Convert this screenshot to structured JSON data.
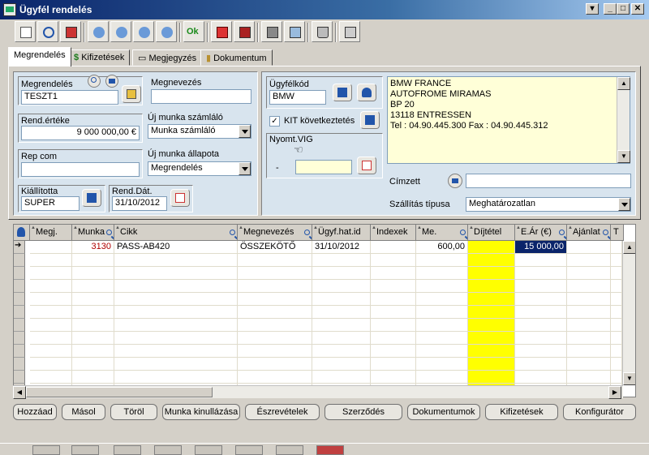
{
  "window": {
    "title": "Ügyfél rendelés",
    "controls": [
      "▾",
      "_",
      "□",
      "✕"
    ]
  },
  "toolbar": {
    "ok_label": "Ok",
    "icons": [
      "new-icon",
      "search-icon",
      "copy-icon",
      "first-icon",
      "prev-icon",
      "next-icon",
      "last-icon",
      "ok-icon",
      "delete-icon",
      "exit-icon",
      "print-icon",
      "preview-icon",
      "trash-icon",
      "stack-icon"
    ]
  },
  "tabs": [
    {
      "label": "Megrendelés",
      "active": true
    },
    {
      "label": "Kifizetések",
      "active": false
    },
    {
      "label": "Megjegyzés",
      "active": false
    },
    {
      "label": "Dokumentum",
      "active": false
    }
  ],
  "form": {
    "order_label": "Megrendelés",
    "order_value": "TESZT1",
    "name_label": "Megnevezés",
    "name_value": "",
    "order_value_label": "Rend.értéke",
    "order_value_amount": "9 000 000,00 €",
    "new_work_account_label": "Új munka számláló",
    "new_work_account_value": "Munka számláló",
    "rep_label": "Rep com",
    "rep_value": "",
    "new_work_status_label": "Új munka állapota",
    "new_work_status_value": "Megrendelés",
    "issuer_label": "Kiállította",
    "issuer_value": "SUPER",
    "order_date_label": "Rend.Dát.",
    "order_date_value": "31/10/2012",
    "customer_code_label": "Ügyfélkód",
    "customer_code_value": "BMW",
    "kit_label": "KIT következtetés",
    "kit_checked": "✓",
    "print_label": "Nyomt.VIG",
    "print_dash": "-",
    "address_lines": [
      "BMW FRANCE",
      "AUTOFROME MIRAMAS",
      "BP 20",
      "13118 ENTRESSEN",
      "Tel : 04.90.445.300 Fax : 04.90.445.312"
    ],
    "recipient_label": "Címzett",
    "recipient_value": "",
    "shipping_label": "Szállítás típusa",
    "shipping_value": "Meghatározatlan"
  },
  "grid": {
    "columns": [
      "Megj.",
      "Munka",
      "Cikk",
      "Megnevezés",
      "Ügyf.hat.id",
      "Indexek",
      "Me.",
      "Díjtétel",
      "E.Ár (€)",
      "Ajánlat",
      "T"
    ],
    "rows": [
      {
        "megj": "",
        "munka": "3130",
        "cikk": "PASS-AB420",
        "megnevezes": "ÖSSZEKÖTŐ",
        "hatid": "31/10/2012",
        "indexek": "",
        "me": "600,00",
        "dijtetel": "",
        "ear": "15 000,00",
        "ajanlat": ""
      }
    ],
    "empty_rows": 11
  },
  "buttons": {
    "add": "Hozzáad",
    "copy": "Másol",
    "delete": "Töröl",
    "work_issue": "Munka kinullázása",
    "remarks": "Észrevételek",
    "contract": "Szerződés",
    "documents": "Dokumentumok",
    "payments": "Kifizetések",
    "configurator": "Konfigurátor"
  },
  "colors": {
    "title_start": "#0a246a",
    "panel_bg": "#d8e4ee",
    "highlight_col": "#ffff00",
    "selected_cell": "#0a246a"
  }
}
